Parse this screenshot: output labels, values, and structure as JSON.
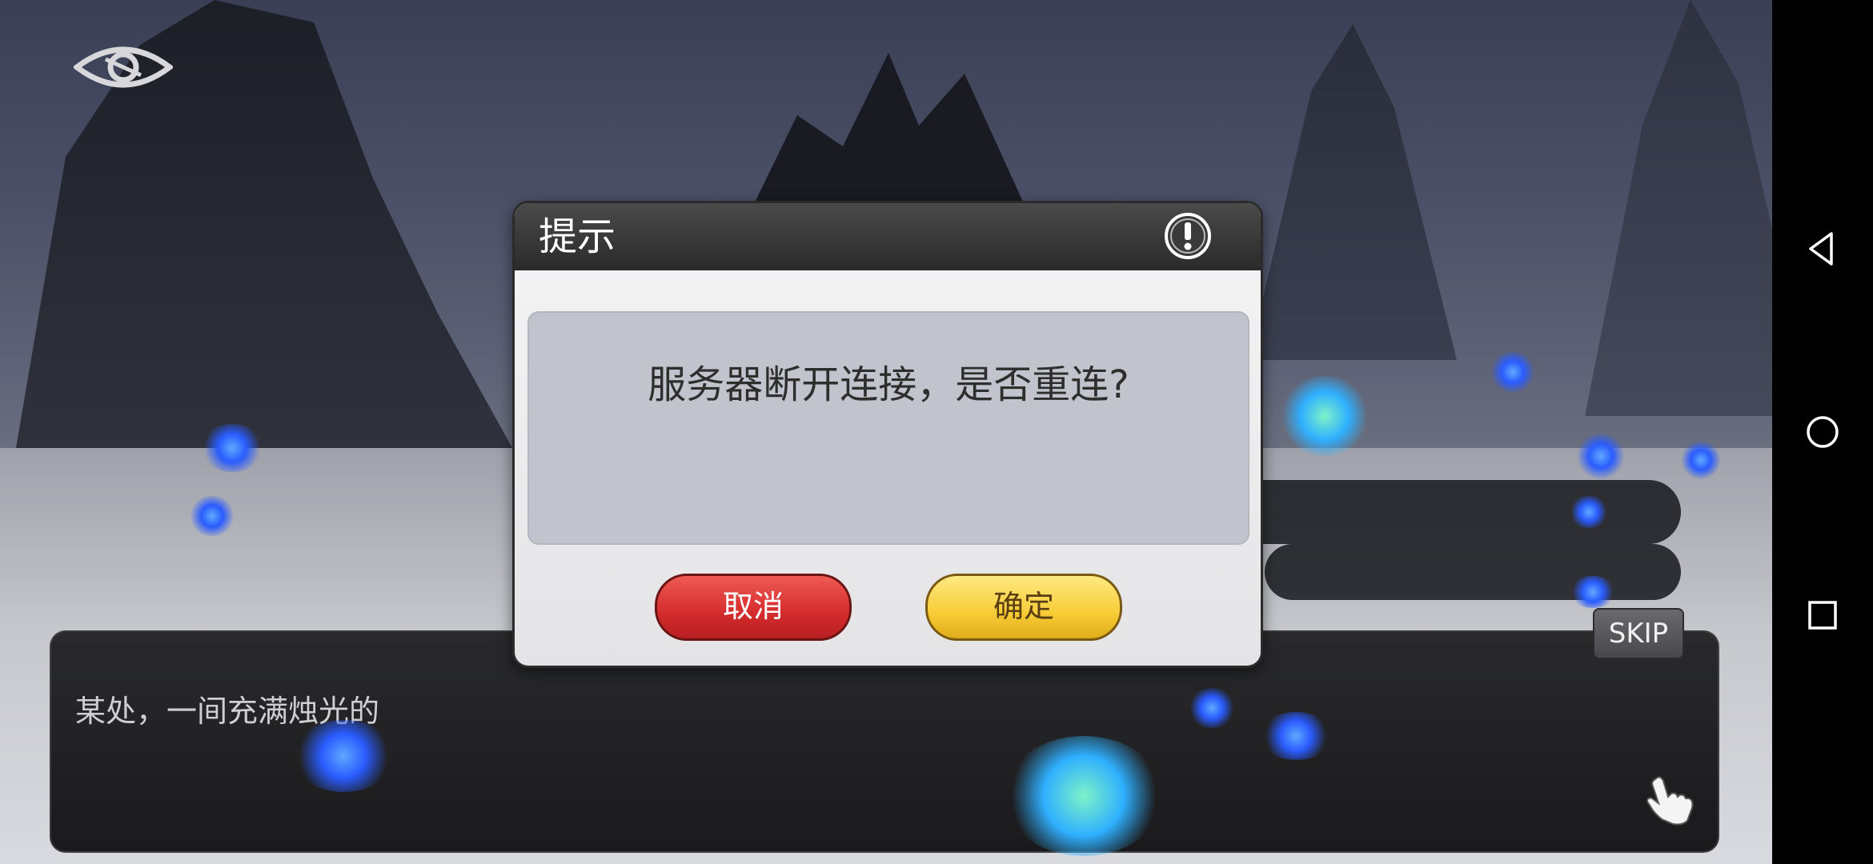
{
  "dialog": {
    "title": "提示",
    "message": "服务器断开连接，是否重连?",
    "cancel_label": "取消",
    "confirm_label": "确定",
    "header_icon": "exclamation-icon"
  },
  "story": {
    "text": "某处，一间充满烛光的",
    "skip_label": "SKIP",
    "advance_icon": "tap-hand-icon"
  },
  "hud": {
    "toggle_icon": "eye-icon"
  },
  "system_nav": {
    "back_icon": "triangle-back-icon",
    "home_icon": "circle-home-icon",
    "recents_icon": "square-recents-icon"
  },
  "colors": {
    "cancel": "#d42c2c",
    "confirm": "#f7cc36",
    "header": "#2a2a2a",
    "message_panel": "#c1c4cc"
  }
}
